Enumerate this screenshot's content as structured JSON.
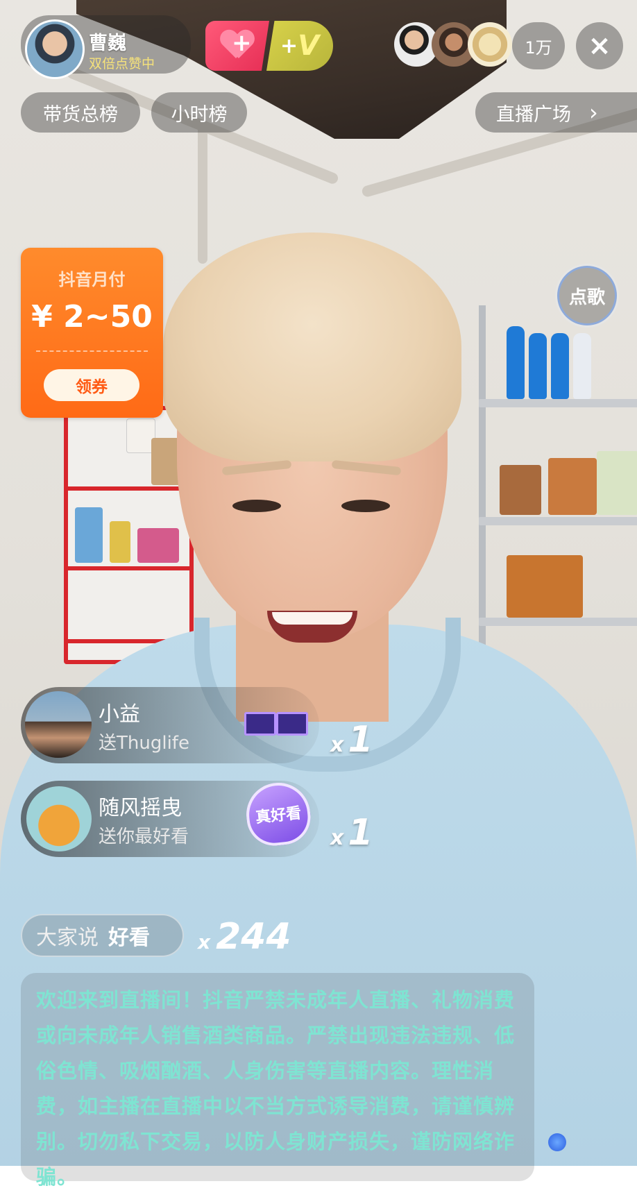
{
  "host": {
    "name": "曹巍",
    "status": "双倍点赞中"
  },
  "top_actions": {
    "like_plus": "+",
    "vip_plus": "+",
    "vip_letter": "V"
  },
  "viewers": {
    "count": "1万"
  },
  "close": {
    "icon": "×"
  },
  "tabs": [
    {
      "label": "带货总榜"
    },
    {
      "label": "小时榜"
    }
  ],
  "plaza": {
    "label": "直播广场",
    "chevron": "›"
  },
  "coupon": {
    "title": "抖音月付",
    "amount": "¥ 2~50",
    "button": "领券"
  },
  "song": {
    "label": "点歌"
  },
  "gifts": [
    {
      "user": "小益",
      "text": "送Thuglife",
      "multiplier": "x",
      "count": "1"
    },
    {
      "user": "随风摇曳",
      "text": "送你最好看",
      "multiplier": "x",
      "count": "1",
      "badge": "真好看"
    }
  ],
  "comment": {
    "prefix": "大家说",
    "word": "好看",
    "multiplier": "x",
    "count": "244"
  },
  "notice": {
    "text": "欢迎来到直播间！抖音严禁未成年人直播、礼物消费或向未成年人销售酒类商品。严禁出现违法违规、低俗色情、吸烟酗酒、人身伤害等直播内容。理性消费，如主播在直播中以不当方式诱导消费，请谨慎辨别。切勿私下交易，以防人身财产损失，谨防网络诈骗。"
  },
  "colors": {
    "coupon": "#ff6a16",
    "notice_text": "#7fe4d2",
    "host_status": "#f6e27a",
    "like": "#e62e55",
    "vip": "#b8b53b"
  }
}
